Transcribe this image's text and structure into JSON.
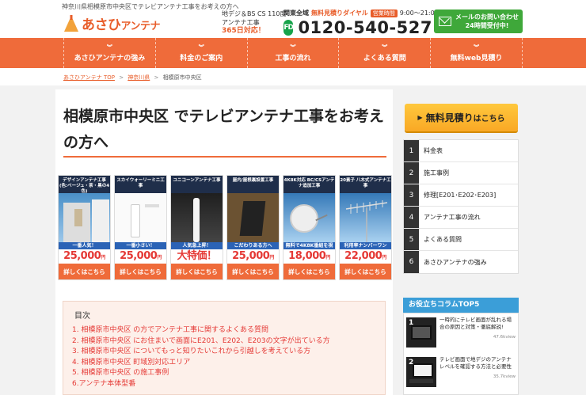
{
  "header": {
    "topline": "神奈川県相模原市中央区でテレビアンテナ工事をお考えの方へ",
    "logo_main": "あさひ",
    "logo_sub": "アンテナ",
    "tagline_1": "地デジ＆BS CS 110度",
    "tagline_2": "アンテナ工事",
    "tagline_3": "365日対応！",
    "phone_area": "関東全域",
    "phone_free": "無料見積りダイヤル",
    "phone_hours_badge": "営業時間",
    "phone_hours": "9:00～21:00",
    "freedial_label": "FD",
    "phone_number": "0120-540-527",
    "mail_line1": "メールのお問い合わせ",
    "mail_line2": "24時間受付中!"
  },
  "nav": {
    "items": [
      {
        "label": "あさひアンテナの強み"
      },
      {
        "label": "料金のご案内"
      },
      {
        "label": "工事の流れ"
      },
      {
        "label": "よくある質問"
      },
      {
        "label": "無料web見積り"
      }
    ],
    "chevron": "︾"
  },
  "breadcrumb": {
    "home": "あさひアンテナ TOP",
    "pref": "神奈川県",
    "current": "相模原市中央区",
    "sep": ">"
  },
  "main": {
    "title": "相模原市中央区 でテレビアンテナ工事をお考えの方へ"
  },
  "products": [
    {
      "name": "デザインアンテナ工事 (色:ベージュ・茶・黒の4色)",
      "badge": "一番人気！",
      "badge_color": "#2b63b6",
      "price": "25,000",
      "unit": "円",
      "sub": "(本体込・税別)",
      "btn": "詳しくはこちら",
      "img": "house"
    },
    {
      "name": "スカイウォーリーミニ工事",
      "badge": "一番小さい！",
      "badge_color": "#2b63b6",
      "price": "25,000",
      "unit": "円",
      "sub": "(本体込・税別)",
      "btn": "詳しくはこちら",
      "img": "white"
    },
    {
      "name": "ユニコーンアンテナ工事",
      "badge": "人気急上昇！",
      "badge_color": "#2b63b6",
      "price": "大特価！",
      "unit": "",
      "sub": "",
      "btn": "詳しくはこちら",
      "img": "unicorn"
    },
    {
      "name": "屋内/屋根裏設置工事",
      "badge": "こだわりある方へ",
      "badge_color": "#2b63b6",
      "price": "25,000",
      "unit": "円",
      "sub": "(本体込・税別)",
      "btn": "詳しくはこちら",
      "img": "dark"
    },
    {
      "name": "4K8K対応 BC/CSアンテナ追加工事",
      "badge": "無料で4K8K番組を視聴可能",
      "badge_color": "#2b63b6",
      "price": "18,000",
      "unit": "円",
      "sub": "(本体込・税別)",
      "btn": "詳しくはこちら",
      "img": "dish"
    },
    {
      "name": "20素子 八木式アンテナ工事",
      "badge": "利用率ナンバーワン",
      "badge_color": "#2b63b6",
      "price": "22,000",
      "unit": "円",
      "sub": "(本体込・税別)",
      "btn": "詳しくはこちら",
      "img": "yagi"
    }
  ],
  "toc": {
    "title": "目次",
    "items": [
      "1. 相模原市中央区 の方でアンテナ工事に関するよくある質問",
      "2. 相模原市中央区 にお住まいで画面にE201、E202、E203の文字が出ている方",
      "3. 相模原市中央区 についてもっと知りたいこれから引越しを考えている方",
      "4. 相模原市中央区 町域別対応エリア",
      "5. 相模原市中央区 の施工事例",
      "6.アンテナ本体型番"
    ]
  },
  "sidebar": {
    "cta_main": "無料見積り",
    "cta_sub": "はこちら",
    "cta_arrow": "▶",
    "menu": [
      {
        "num": "1",
        "label": "料金表"
      },
      {
        "num": "2",
        "label": "施工事例"
      },
      {
        "num": "3",
        "label": "修理[E201･E202･E203]"
      },
      {
        "num": "4",
        "label": "アンテナ工事の流れ"
      },
      {
        "num": "5",
        "label": "よくある質問"
      },
      {
        "num": "6",
        "label": "あさひアンテナの強み"
      }
    ],
    "column_title": "お役立ちコラムTOP5",
    "columns": [
      {
        "rank": "1",
        "title": "一時的にテレビ画面が乱れる場合の原因と対策・徹底解説!",
        "views": "47.6kview"
      },
      {
        "rank": "2",
        "title": "テレビ画面で地デジのアンテナレベルを確認する方法と必要性",
        "views": "35.7kview"
      }
    ]
  },
  "colors": {
    "accent": "#ef6b3a",
    "green": "#3fa83a",
    "yellow": "#f9a825",
    "blue": "#3b9ed8"
  }
}
